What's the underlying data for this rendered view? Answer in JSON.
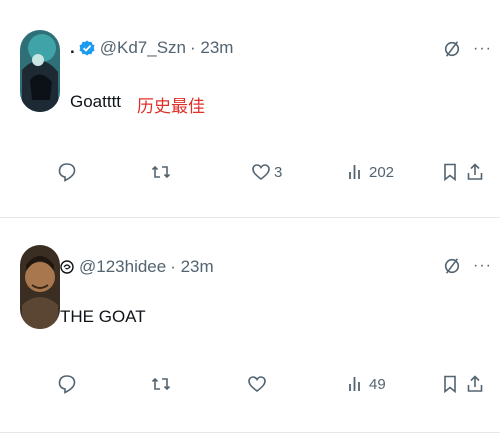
{
  "posts": [
    {
      "handle": "@Kd7_Szn",
      "time": "· 23m",
      "dot": ".",
      "text": "Goatttt",
      "translation": "历史最佳",
      "avatar_icon": "avatar-photo",
      "badge_icon": "verified-badge-icon",
      "actions": {
        "reply": "",
        "repost": "",
        "like": "3",
        "views": "202"
      }
    },
    {
      "handle": "@123hidee",
      "time": "· 23m",
      "text": "THE GOAT",
      "avatar_icon": "avatar-photo",
      "badge_icon": "swirl-emoji-icon",
      "actions": {
        "reply": "",
        "repost": "",
        "like": "",
        "views": "49"
      }
    }
  ],
  "more_label": "···",
  "colors": {
    "text": "#0f1419",
    "muted": "#536471",
    "verified": "#1d9bf0",
    "translation": "#e0302a",
    "divider": "#e7e7e7"
  }
}
